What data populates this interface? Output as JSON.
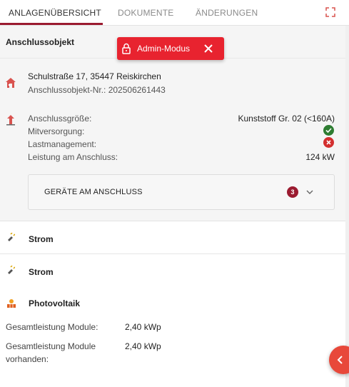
{
  "tabs": [
    {
      "label": "ANLAGENÜBERSICHT",
      "active": true
    },
    {
      "label": "DOKUMENTE",
      "active": false
    },
    {
      "label": "ÄNDERUNGEN",
      "active": false
    }
  ],
  "colors": {
    "accent": "#9b1b30",
    "admin_badge": "#e8232f",
    "status_ok": "#2e7d32",
    "status_no": "#d32f2f",
    "fab": "#e8483a"
  },
  "section": {
    "title": "Anschlussobjekt"
  },
  "admin_badge": {
    "label": "Admin-Modus",
    "lock_icon": "lock-icon",
    "close_icon": "close-icon"
  },
  "object": {
    "address": "Schulstraße 17, 35447 Reiskirchen",
    "number_label": "Anschlussobjekt-Nr.: 202506261443"
  },
  "connection": {
    "rows": [
      {
        "label": "Anschlussgröße:",
        "value": "Kunststoff Gr. 02 (<160A)"
      },
      {
        "label": "Mitversorgung:",
        "status": "ok"
      },
      {
        "label": "Lastmanagement:",
        "status": "no"
      },
      {
        "label": "Leistung am Anschluss:",
        "value": "124 kW"
      }
    ]
  },
  "devices": {
    "label": "GERÄTE AM ANSCHLUSS",
    "count": "3"
  },
  "media": [
    {
      "title": "Strom",
      "icon": "power-plug-icon"
    },
    {
      "title": "Strom",
      "icon": "power-plug-icon"
    }
  ],
  "pv": {
    "title": "Photovoltaik",
    "icon": "solar-panel-icon",
    "rows": [
      {
        "label_line1": "Gesamtleistung Module:",
        "label_line2": "",
        "value": "2,40 kWp"
      },
      {
        "label_line1": "Gesamtleistung Module",
        "label_line2": "vorhanden:",
        "value": "2,40 kWp"
      }
    ]
  }
}
